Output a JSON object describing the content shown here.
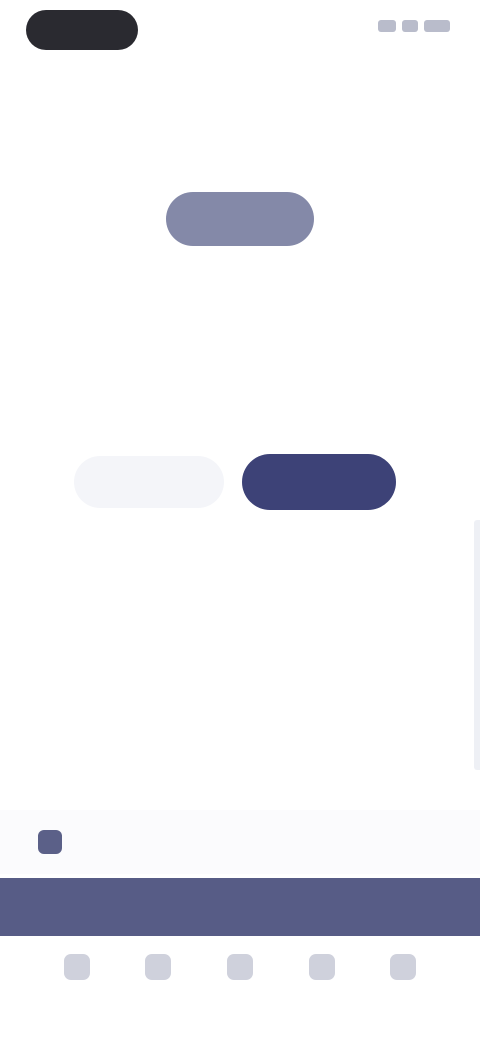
{
  "status_bar": {
    "time": "",
    "caption": ""
  },
  "header": {
    "back_label": ""
  },
  "hero": {
    "button_label": ""
  },
  "content": {
    "muted_line": "",
    "section_title": "",
    "segment_left_label": "",
    "segment_right_label": "",
    "sub_caption": "",
    "danger_label": ""
  },
  "info_row": {
    "text": "",
    "icon": "info-icon"
  },
  "banner": {
    "text": ""
  },
  "tabs": [
    {
      "label": "",
      "icon": "home-icon"
    },
    {
      "label": "",
      "icon": "list-icon"
    },
    {
      "label": "",
      "icon": "add-icon"
    },
    {
      "label": "",
      "icon": "chat-icon"
    },
    {
      "label": "",
      "icon": "profile-icon"
    }
  ],
  "colors": {
    "accent": "#3d4277",
    "accent_muted": "#8489a8",
    "banner": "#575c86",
    "danger": "#f08a6e"
  }
}
